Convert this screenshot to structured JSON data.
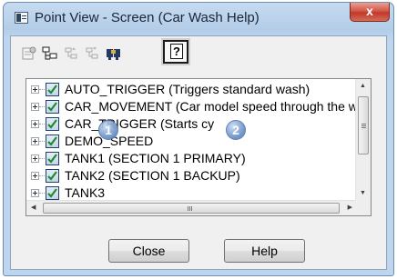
{
  "window": {
    "title": "Point View - Screen (Car Wash Help)",
    "close_label": "x"
  },
  "toolbar": {
    "icons": [
      "properties-icon",
      "tree-structure-icon",
      "expand-tree-icon",
      "collapse-tree-icon",
      "find-icon",
      "help-icon"
    ],
    "help_label": "?"
  },
  "tree": {
    "rows": [
      {
        "label": "AUTO_TRIGGER (Triggers standard wash)"
      },
      {
        "label": "CAR_MOVEMENT (Car model speed through the w"
      },
      {
        "label": "CAR_TRIGGER (Starts cy"
      },
      {
        "label": "DEMO_SPEED"
      },
      {
        "label": "TANK1 (SECTION 1 PRIMARY)"
      },
      {
        "label": "TANK2 (SECTION 1 BACKUP)"
      },
      {
        "label": "TANK3"
      }
    ]
  },
  "callouts": [
    "1",
    "2"
  ],
  "buttons": {
    "close": "Close",
    "help": "Help"
  },
  "colors": {
    "checkbox_check": "#1f8a2e",
    "callout": "#6f95c8",
    "close_button": "#c0392b"
  }
}
